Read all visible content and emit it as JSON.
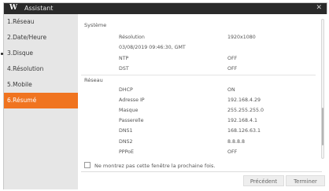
{
  "window": {
    "title": "Assistant",
    "logo": "W"
  },
  "sidebar": {
    "items": [
      {
        "label": "1.Réseau"
      },
      {
        "label": "2.Date/Heure"
      },
      {
        "label": "3.Disque"
      },
      {
        "label": "4.Résolution"
      },
      {
        "label": "5.Mobile"
      },
      {
        "label": "6.Résumé",
        "active": true
      }
    ]
  },
  "summary": {
    "system": {
      "heading": "Système",
      "rows": [
        {
          "key": "Résolution",
          "value": "1920x1080"
        },
        {
          "key": "03/08/2019 09:46:30, GMT",
          "value": ""
        },
        {
          "key": "NTP",
          "value": "OFF"
        },
        {
          "key": "DST",
          "value": "OFF"
        }
      ]
    },
    "network": {
      "heading": "Réseau",
      "rows": [
        {
          "key": "DHCP",
          "value": "ON"
        },
        {
          "key": "Adresse IP",
          "value": "192.168.4.29"
        },
        {
          "key": "Masque",
          "value": "255.255.255.0"
        },
        {
          "key": "Passerelle",
          "value": "192.168.4.1"
        },
        {
          "key": "DNS1",
          "value": "168.126.63.1"
        },
        {
          "key": "DNS2",
          "value": "8.8.8.8"
        },
        {
          "key": "PPPoE",
          "value": "OFF"
        }
      ]
    }
  },
  "footer": {
    "checkbox_label": "Ne montrez pas cette fenêtre la prochaine fois.",
    "checkbox_checked": false,
    "prev_label": "Précédent",
    "finish_label": "Terminer"
  },
  "colors": {
    "accent": "#f07420",
    "titlebar": "#2a2a2a",
    "sidebar": "#e6e6e6"
  }
}
